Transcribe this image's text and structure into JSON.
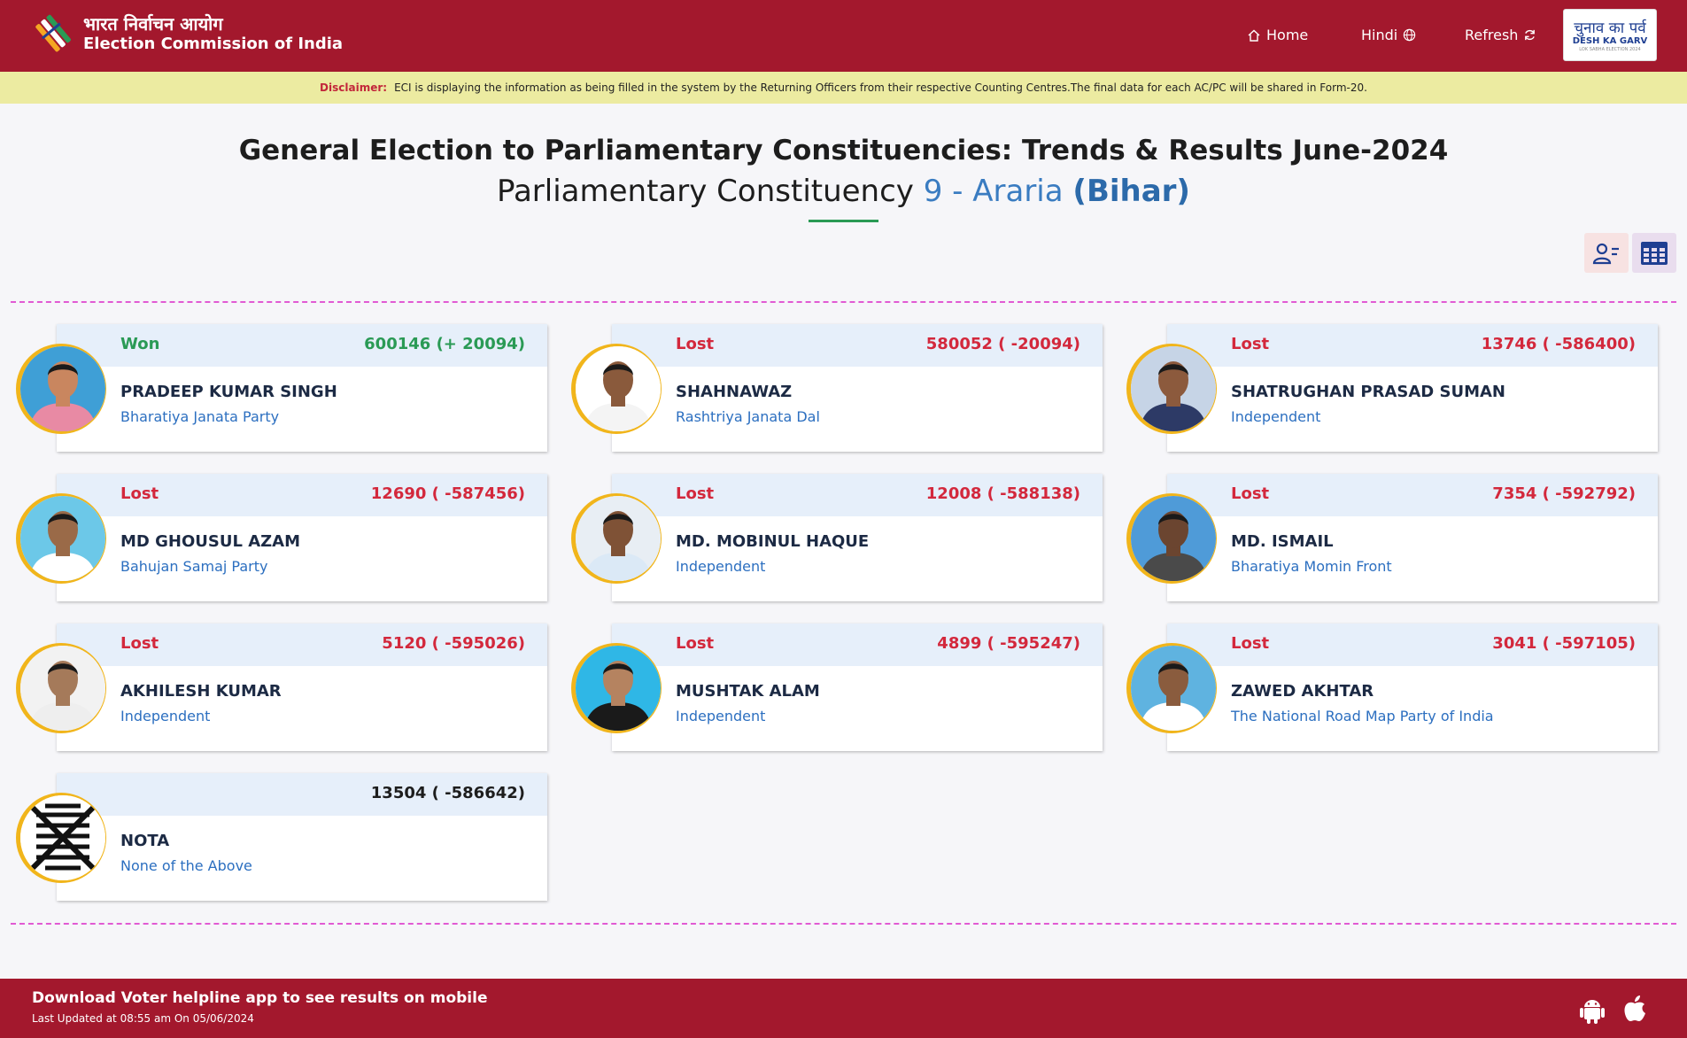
{
  "header": {
    "brand_hindi": "भारत निर्वाचन आयोग",
    "brand_english": "Election Commission of India",
    "nav": {
      "home": "Home",
      "hindi": "Hindi",
      "refresh": "Refresh"
    },
    "desh_logo": {
      "hindi": "चुनाव का पर्व",
      "english": "DESH KA GARV",
      "sub": "LOK SABHA ELECTION 2024"
    }
  },
  "disclaimer": {
    "label": "Disclaimer:",
    "text": "ECI is displaying the information as being filled in the system by the Returning Officers from their respective Counting Centres.The final data for each AC/PC will be shared in Form-20."
  },
  "title": {
    "line1": "General Election to Parliamentary Constituencies: Trends & Results June-2024",
    "line2_prefix": "Parliamentary Constituency",
    "line2_number": "9 - Araria",
    "line2_state": "(Bihar)"
  },
  "candidates": [
    {
      "status": "Won",
      "votes": "600146 (+ 20094)",
      "name": "PRADEEP KUMAR SINGH",
      "party": "Bharatiya Janata Party",
      "shirt": "#e88aa4",
      "skin": "#c9865f",
      "bg": "#3f9fd6"
    },
    {
      "status": "Lost",
      "votes": "580052 ( -20094)",
      "name": "SHAHNAWAZ",
      "party": "Rashtriya Janata Dal",
      "shirt": "#f4f4f4",
      "skin": "#8a5a3c",
      "bg": "#ffffff"
    },
    {
      "status": "Lost",
      "votes": "13746 ( -586400)",
      "name": "SHATRUGHAN PRASAD SUMAN",
      "party": "Independent",
      "shirt": "#2d3a66",
      "skin": "#8c5a3d",
      "bg": "#c6d4e6"
    },
    {
      "status": "Lost",
      "votes": "12690 ( -587456)",
      "name": "MD GHOUSUL AZAM",
      "party": "Bahujan Samaj Party",
      "shirt": "#ffffff",
      "skin": "#9a6a48",
      "bg": "#6cc8e8"
    },
    {
      "status": "Lost",
      "votes": "12008 ( -588138)",
      "name": "MD. MOBINUL HAQUE",
      "party": "Independent",
      "shirt": "#dbe9f6",
      "skin": "#7f5236",
      "bg": "#e8eef4"
    },
    {
      "status": "Lost",
      "votes": "7354 ( -592792)",
      "name": "MD. ISMAIL",
      "party": "Bharatiya Momin Front",
      "shirt": "#4a4a4a",
      "skin": "#6b4530",
      "bg": "#4f9bd8"
    },
    {
      "status": "Lost",
      "votes": "5120 ( -595026)",
      "name": "AKHILESH KUMAR",
      "party": "Independent",
      "shirt": "#eeeeee",
      "skin": "#a57a5a",
      "bg": "#f2f2f2"
    },
    {
      "status": "Lost",
      "votes": "4899 ( -595247)",
      "name": "MUSHTAK ALAM",
      "party": "Independent",
      "shirt": "#1a1a1a",
      "skin": "#b58360",
      "bg": "#2fb7e6"
    },
    {
      "status": "Lost",
      "votes": "3041 ( -597105)",
      "name": "ZAWED AKHTAR",
      "party": "The National Road Map Party of India",
      "shirt": "#ffffff",
      "skin": "#8a5c3e",
      "bg": "#5fb3e0"
    }
  ],
  "nota": {
    "votes": "13504 ( -586642)",
    "name": "NOTA",
    "party": "None of the Above"
  },
  "footer": {
    "line1": "Download Voter helpline app to see results on mobile",
    "line2": "Last Updated at 08:55 am On 05/06/2024"
  },
  "colors": {
    "header_bg": "#a3182d",
    "disclaimer_bg": "#eceba1",
    "won": "#2a9a55",
    "lost": "#d3283c",
    "party_link": "#2c6fc0",
    "ring": "#f1b51b"
  }
}
